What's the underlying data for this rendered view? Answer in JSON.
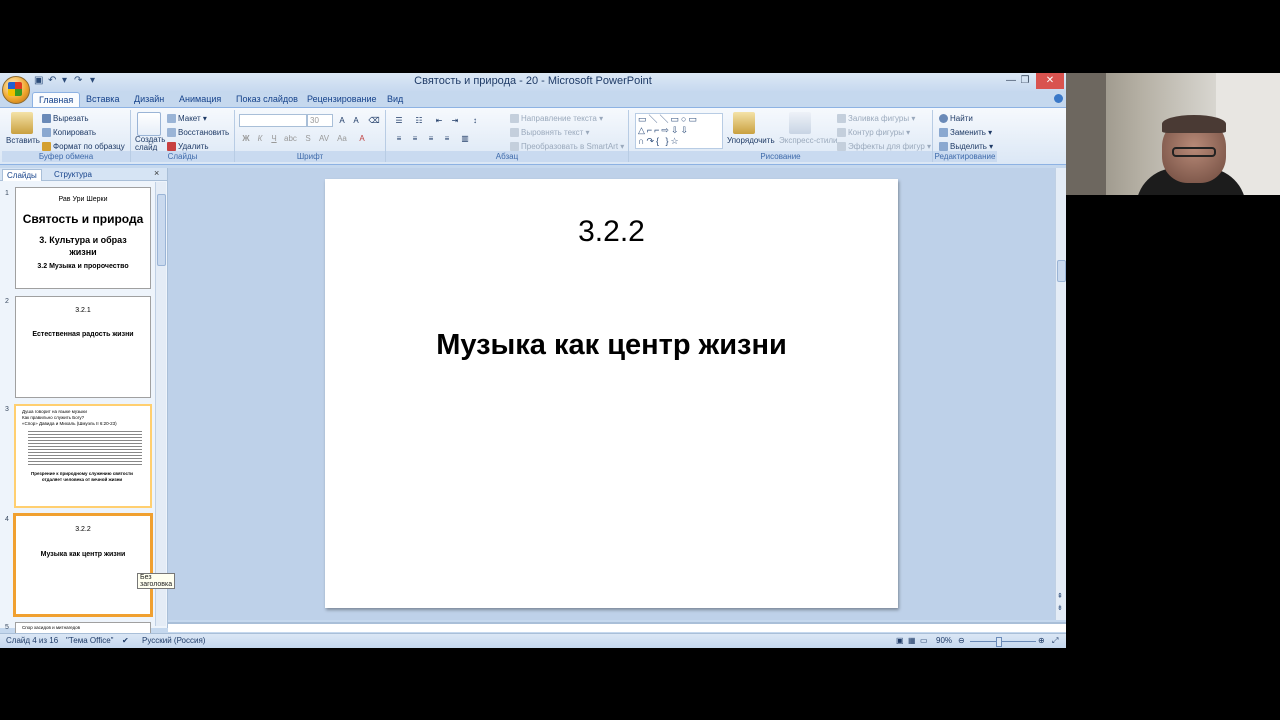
{
  "window": {
    "title": "Святость и природа - 20 - Microsoft PowerPoint"
  },
  "tabs": [
    "Главная",
    "Вставка",
    "Дизайн",
    "Анимация",
    "Показ слайдов",
    "Рецензирование",
    "Вид"
  ],
  "ribbon": {
    "clipboard": {
      "paste": "Вставить",
      "cut": "Вырезать",
      "copy": "Копировать",
      "format_painter": "Формат по образцу",
      "label": "Буфер обмена"
    },
    "slides": {
      "new_slide": "Создать слайд",
      "layout": "Макет",
      "reset": "Восстановить",
      "delete": "Удалить",
      "label": "Слайды"
    },
    "font": {
      "size": "30",
      "label": "Шрифт"
    },
    "paragraph": {
      "text_direction": "Направление текста",
      "align_text": "Выровнять текст",
      "smartart": "Преобразовать в SmartArt",
      "label": "Абзац"
    },
    "drawing": {
      "arrange": "Упорядочить",
      "quick_styles": "Экспресс-стили",
      "shape_fill": "Заливка фигуры",
      "shape_outline": "Контур фигуры",
      "shape_effects": "Эффекты для фигур",
      "label": "Рисование"
    },
    "editing": {
      "find": "Найти",
      "replace": "Заменить",
      "select": "Выделить",
      "label": "Редактирование"
    }
  },
  "left_panel": {
    "tabs": [
      "Слайды",
      "Структура"
    ],
    "tooltip": "Без заголовка",
    "thumbs": {
      "s1": {
        "author": "Рав Ури Шерки",
        "title": "Святость и природа",
        "line1": "3. Культура  и образ",
        "line2": "жизни",
        "line3": "3.2 Музыка и пророчество"
      },
      "s2": {
        "num": "3.2.1",
        "title": "Естественная радость жизни"
      },
      "s3": {
        "b1": "Душа говорит на языке музыки",
        "b2": "Как правильно служить Богу?",
        "b3": "«Спор» Давида и Михаль (Шмуэль II 6:20-23)",
        "footer": "Презрение к природному служению святости отдаляет человека от вечной жизни"
      },
      "s4": {
        "num": "3.2.2",
        "title": "Музыка как центр жизни"
      },
      "s5": {
        "b1": "Спор хасидов и митнагедов"
      }
    }
  },
  "slide": {
    "number": "3.2.2",
    "title": "Музыка как центр жизни"
  },
  "status": {
    "slide_of": "Слайд 4 из 16",
    "theme": "\"Тема Office\"",
    "language": "Русский (Россия)",
    "zoom": "90%"
  }
}
